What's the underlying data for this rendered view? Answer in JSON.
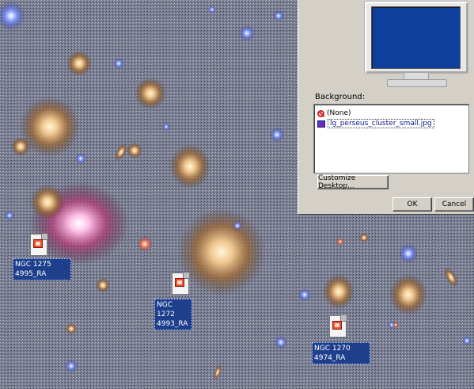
{
  "dialog": {
    "background_label": "Background:",
    "background_items": [
      {
        "label": "(None)",
        "icon": "none-icon",
        "selected": false
      },
      {
        "label": "lg_perseus_cluster_small.jpg",
        "icon": "jpg-file-icon",
        "selected": true
      }
    ],
    "customize_label": "Customize Desktop...",
    "ok_label": "OK",
    "cancel_label": "Cancel",
    "preview_screen_color": "#0f3f9d"
  },
  "desktop": {
    "wallpaper": "galaxy-cluster-photo",
    "icons": [
      {
        "line1": "NGC 1275",
        "line2": "4995_RA",
        "icon": "image-file-icon"
      },
      {
        "line1": "NGC 1272",
        "line2": "4993_RA",
        "icon": "image-file-icon"
      },
      {
        "line1": "NGC 1270",
        "line2": "4974_RA",
        "icon": "image-file-icon"
      }
    ]
  }
}
